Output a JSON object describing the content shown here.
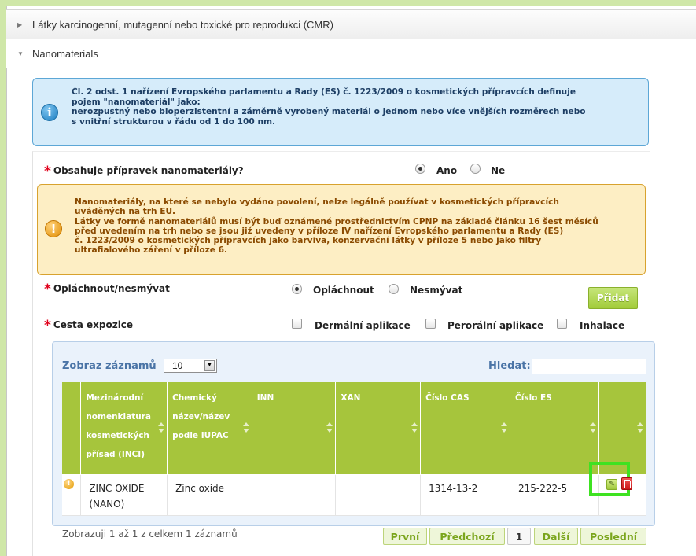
{
  "accordion": {
    "cmr": {
      "label": "Látky karcinogenní, mutagenní nebo toxické pro reprodukci (CMR)",
      "state": "collapsed"
    },
    "nano": {
      "label": "Nanomaterials",
      "state": "expanded"
    }
  },
  "info_box": {
    "text": "Čl. 2 odst. 1 nařízení Evropského parlamentu a Rady (ES) č. 1223/2009 o kosmetických přípravcích definuje\npojem \"nanomateriál\" jako:\nnerozpustný nebo bioperzistentní a záměrně vyrobený materiál o jednom nebo více vnějších rozměrech nebo\ns vnitřní strukturou v řádu od 1 do 100 nm."
  },
  "q_contains": {
    "label": "Obsahuje přípravek nanomateriály?",
    "options": [
      {
        "label": "Ano",
        "selected": true
      },
      {
        "label": "Ne",
        "selected": false
      }
    ]
  },
  "warning_box": {
    "text": "Nanomateriály, na které se nebylo vydáno povolení, nelze legálně používat v kosmetických přípravcích\nuváděných na trh EU.\nLátky ve formě nanomateriálů musí být buď oznámené prostřednictvím CPNP na základě článku 16 šest měsíců\npřed uvedením na trh nebo se jsou již uvedeny v příloze IV nařízení Evropského parlamentu a Rady (ES)\nč. 1223/2009 o kosmetických přípravcích jako barviva, konzervační látky v příloze 5 nebo jako filtry\nultrafialového záření v příloze 6."
  },
  "q_rinse": {
    "label": "Opláchnout/nesmývat",
    "options": [
      {
        "label": "Opláchnout",
        "selected": true
      },
      {
        "label": "Nesmývat",
        "selected": false
      }
    ]
  },
  "add_button": "Přidat",
  "q_exposure": {
    "label": "Cesta expozice",
    "options": [
      {
        "label": "Dermální aplikace",
        "checked": false
      },
      {
        "label": "Perorální aplikace",
        "checked": false
      },
      {
        "label": "Inhalace",
        "checked": false
      }
    ]
  },
  "table": {
    "length_label": "Zobraz záznamů",
    "length_value": "10",
    "search_label": "Hledat:",
    "search_value": "",
    "columns": [
      "Mezinárodní nomenklatura kosmetických přísad (INCI)",
      "Chemický název/název podle IUPAC",
      "INN",
      "XAN",
      "Číslo CAS",
      "Číslo ES",
      ""
    ],
    "rows": [
      {
        "inci": "ZINC OXIDE (NANO)",
        "chemical": "Zinc oxide",
        "inn": "",
        "xan": "",
        "cas": "1314-13-2",
        "es": "215-222-5"
      }
    ],
    "info": "Zobrazuji 1 až 1 z celkem 1 záznamů",
    "pagination": {
      "first": "První",
      "prev": "Předchozí",
      "current": "1",
      "next": "Další",
      "last": "Poslední"
    }
  },
  "icons": {
    "info": "info-icon",
    "warning": "warning-icon",
    "edit": "pencil-edit-icon",
    "delete": "trash-delete-icon",
    "accent": "#a6c53c",
    "highlight": "#3ee221"
  }
}
